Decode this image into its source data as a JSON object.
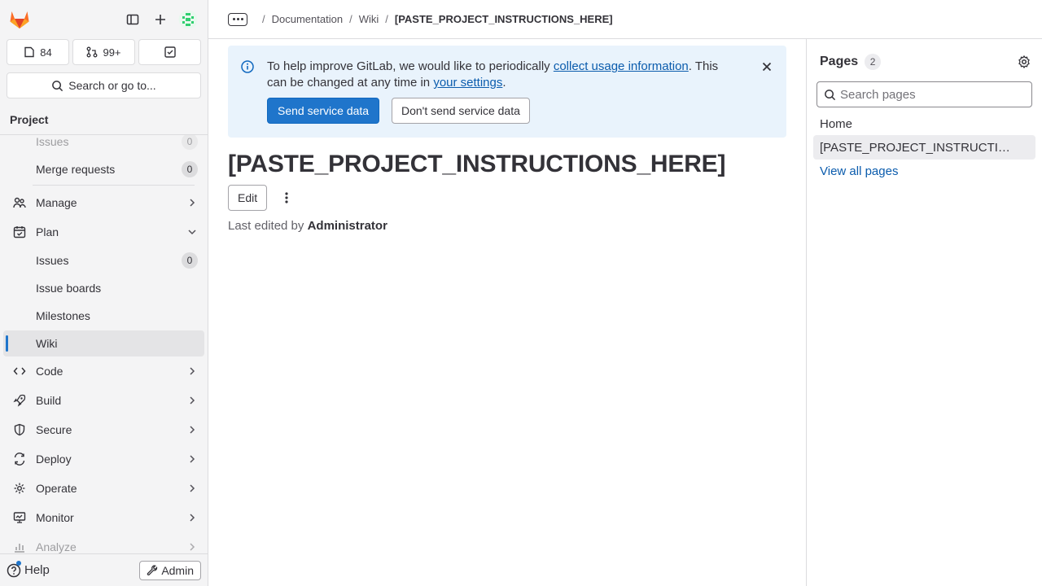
{
  "sidebar": {
    "counters": {
      "issues": "84",
      "merge_requests": "99+"
    },
    "search_label": "Search or go to...",
    "context_title": "Project",
    "items": {
      "issues_partial": {
        "label": "Issues",
        "count": "0"
      },
      "merge_requests": {
        "label": "Merge requests",
        "count": "0"
      },
      "manage": {
        "label": "Manage"
      },
      "plan": {
        "label": "Plan"
      },
      "plan_issues": {
        "label": "Issues",
        "count": "0"
      },
      "issue_boards": {
        "label": "Issue boards"
      },
      "milestones": {
        "label": "Milestones"
      },
      "wiki": {
        "label": "Wiki"
      },
      "code": {
        "label": "Code"
      },
      "build": {
        "label": "Build"
      },
      "secure": {
        "label": "Secure"
      },
      "deploy": {
        "label": "Deploy"
      },
      "operate": {
        "label": "Operate"
      },
      "monitor": {
        "label": "Monitor"
      },
      "analyze": {
        "label": "Analyze"
      }
    },
    "help_label": "Help",
    "admin_label": "Admin"
  },
  "breadcrumb": {
    "items": [
      "Documentation",
      "Wiki"
    ],
    "current": "[PASTE_PROJECT_INSTRUCTIONS_HERE]"
  },
  "alert": {
    "text_before": "To help improve GitLab, we would like to periodically ",
    "link1": "collect usage information",
    "text_middle": ". This can be changed at any time in ",
    "link2": "your settings",
    "text_after": ".",
    "primary_button": "Send service data",
    "secondary_button": "Don't send service data"
  },
  "page": {
    "title": "[PASTE_PROJECT_INSTRUCTIONS_HERE]",
    "edit_label": "Edit",
    "last_edited_prefix": "Last edited by ",
    "last_edited_by": "Administrator"
  },
  "pages_sidebar": {
    "title": "Pages",
    "count": "2",
    "search_placeholder": "Search pages",
    "pages": [
      "Home",
      "[PASTE_PROJECT_INSTRUCTI…"
    ],
    "view_all": "View all pages"
  },
  "colors": {
    "accent": "#1f75cb",
    "link": "#0b5cad",
    "alert_bg": "#e9f3fc"
  }
}
